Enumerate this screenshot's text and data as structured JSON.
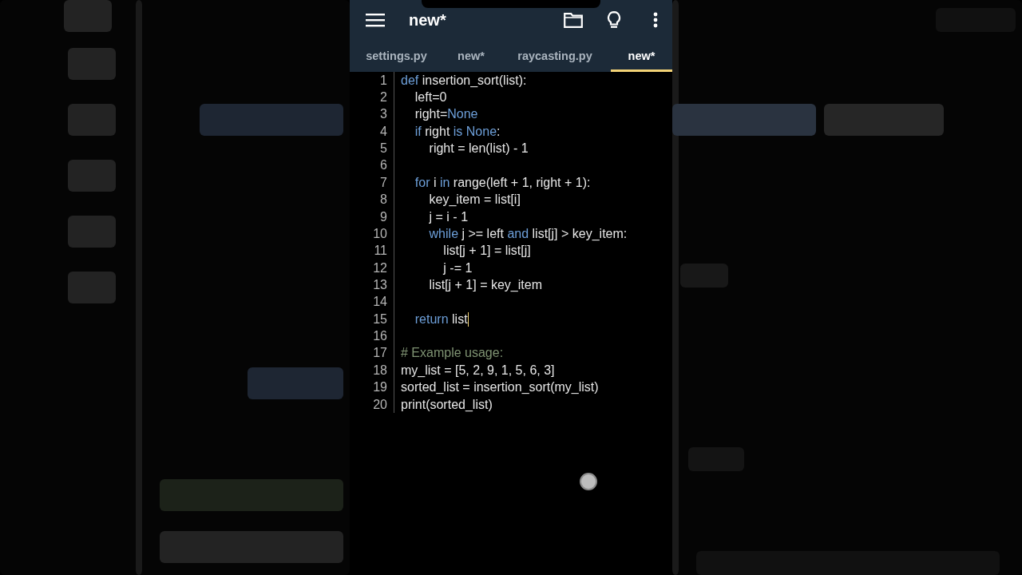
{
  "app_bar": {
    "title": "new*"
  },
  "tabs": [
    {
      "label": "settings.py",
      "selected": false
    },
    {
      "label": "new*",
      "selected": false
    },
    {
      "label": "raycasting.py",
      "selected": false
    },
    {
      "label": "new*",
      "selected": true
    }
  ],
  "editor": {
    "lines": [
      {
        "number": "1",
        "cursor": false,
        "tokens": [
          {
            "text": "def",
            "kind": "keyword"
          },
          {
            "text": " insertion_sort(list):",
            "kind": "plain"
          }
        ]
      },
      {
        "number": "2",
        "cursor": false,
        "tokens": [
          {
            "text": "    left=0",
            "kind": "plain"
          }
        ]
      },
      {
        "number": "3",
        "cursor": false,
        "tokens": [
          {
            "text": "    right=",
            "kind": "plain"
          },
          {
            "text": "None",
            "kind": "keyword"
          }
        ]
      },
      {
        "number": "4",
        "cursor": false,
        "tokens": [
          {
            "text": "    if",
            "kind": "keyword"
          },
          {
            "text": " right ",
            "kind": "plain"
          },
          {
            "text": "is None",
            "kind": "keyword"
          },
          {
            "text": ":",
            "kind": "plain"
          }
        ]
      },
      {
        "number": "5",
        "cursor": false,
        "tokens": [
          {
            "text": "        right = len(list) - 1",
            "kind": "plain"
          }
        ]
      },
      {
        "number": "6",
        "cursor": false
      },
      {
        "number": "7",
        "cursor": false,
        "tokens": [
          {
            "text": "    for",
            "kind": "keyword"
          },
          {
            "text": " i ",
            "kind": "plain"
          },
          {
            "text": "in",
            "kind": "keyword"
          },
          {
            "text": " range(left + 1, right + 1):",
            "kind": "plain"
          }
        ]
      },
      {
        "number": "8",
        "cursor": false,
        "tokens": [
          {
            "text": "        key_item = list[i]",
            "kind": "plain"
          }
        ]
      },
      {
        "number": "9",
        "cursor": false,
        "tokens": [
          {
            "text": "        j = i - 1",
            "kind": "plain"
          }
        ]
      },
      {
        "number": "10",
        "cursor": false,
        "tokens": [
          {
            "text": "        while",
            "kind": "keyword"
          },
          {
            "text": " j >= left ",
            "kind": "plain"
          },
          {
            "text": "and",
            "kind": "keyword"
          },
          {
            "text": " list[j] > key_item:",
            "kind": "plain"
          }
        ]
      },
      {
        "number": "11",
        "cursor": false,
        "tokens": [
          {
            "text": "            list[j + 1] = list[j]",
            "kind": "plain"
          }
        ]
      },
      {
        "number": "12",
        "cursor": false,
        "tokens": [
          {
            "text": "            j -= 1",
            "kind": "plain"
          }
        ]
      },
      {
        "number": "13",
        "cursor": false,
        "tokens": [
          {
            "text": "        list[j + 1] = key_item",
            "kind": "plain"
          }
        ]
      },
      {
        "number": "14",
        "cursor": false
      },
      {
        "number": "15",
        "cursor": true,
        "tokens": [
          {
            "text": "    return",
            "kind": "keyword"
          },
          {
            "text": " list",
            "kind": "plain"
          }
        ]
      },
      {
        "number": "16",
        "cursor": false
      },
      {
        "number": "17",
        "cursor": false,
        "tokens": [
          {
            "text": "# Example usage:",
            "kind": "comment"
          }
        ]
      },
      {
        "number": "18",
        "cursor": false,
        "tokens": [
          {
            "text": "my_list = [5, 2, 9, 1, 5, 6, 3]",
            "kind": "plain"
          }
        ]
      },
      {
        "number": "19",
        "cursor": false,
        "tokens": [
          {
            "text": "sorted_list = insertion_sort(my_list)",
            "kind": "plain"
          }
        ]
      },
      {
        "number": "20",
        "cursor": false,
        "tokens": [
          {
            "text": "print(sorted_list)",
            "kind": "plain"
          }
        ]
      }
    ]
  }
}
